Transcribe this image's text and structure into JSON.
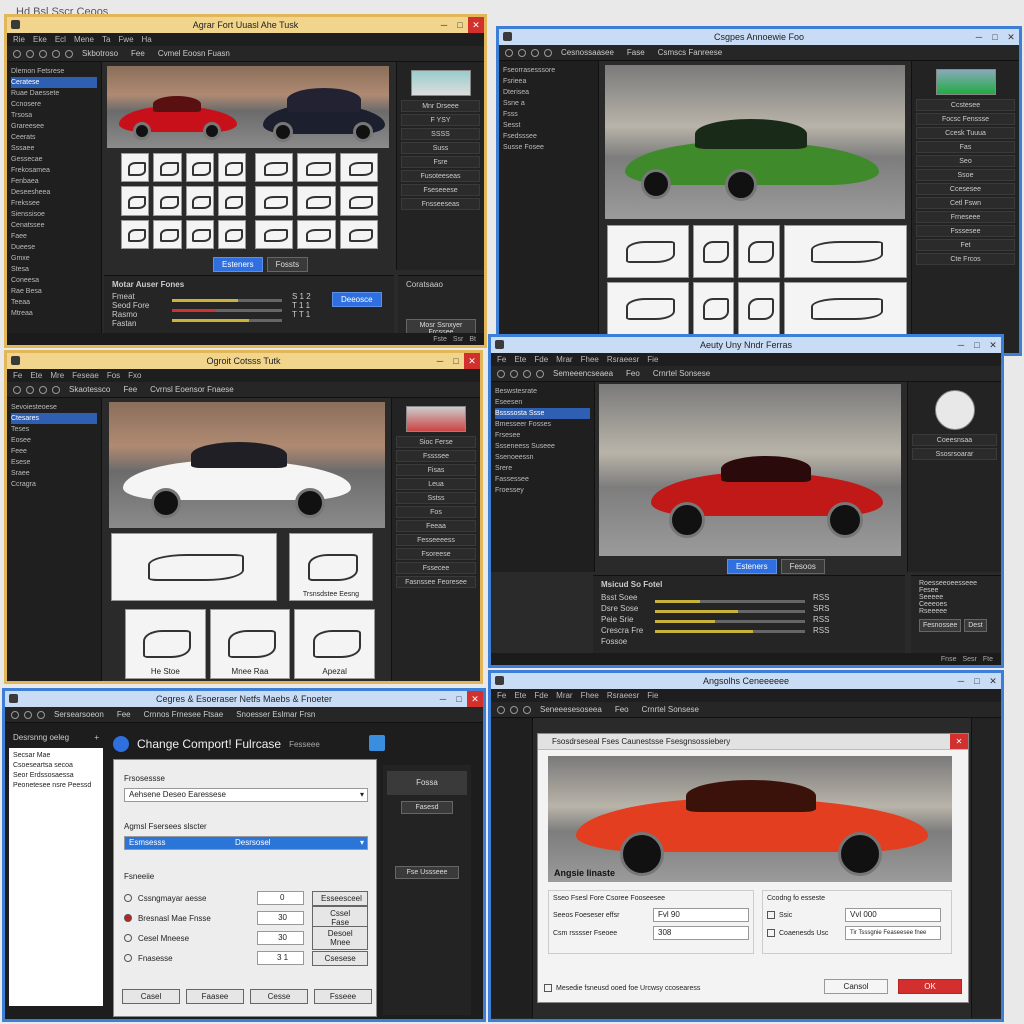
{
  "page": {
    "title": "Hd Bsl Sscr Ceoos"
  },
  "w1": {
    "title": "Agrar Fort Uuasl Ahe Tusk",
    "menu": [
      "Rie",
      "Eke",
      "Ecl",
      "Mene",
      "Ta",
      "Fwe",
      "Ha"
    ],
    "toolbar_labels": [
      "Skbotroso",
      "Fee",
      "Cvmel Eoosn Fuasn"
    ],
    "tree": [
      "Dlemon Fetsrese",
      "Ceratese",
      "Ruae Daessete",
      "Ccnosere",
      "Trsosa",
      "Grareesee",
      "Ceerats",
      "Sssaee",
      "Gessecae",
      "Frekosamea",
      "Fenbaea",
      "Deseesheea",
      "Frekssee",
      "Sienssisoe",
      "Cenatssee",
      "Faee",
      "Dueese",
      "Gmxe",
      "Stesa",
      "Coneesa",
      "Rae Besa",
      "Teeaa",
      "Mtreaa"
    ],
    "rpanel": [
      "Mnr Drseee",
      "F YSY",
      "SSSS",
      "Suss",
      "Fsre",
      "Fusoteeseas",
      "Fseseeese",
      "Fnsseeseas"
    ],
    "bottom_title": "Motar Auser Fones",
    "bottom_rows": [
      "Fmeat",
      "Seod Fore",
      "Rasmo",
      "Fastan"
    ],
    "bottom_vals": [
      "S 1 2",
      "T 1 1",
      "T T 1"
    ],
    "primary_btn": "Deeosce",
    "right_title": "Coratsaao",
    "right_btn": "Mosr Ssnxyer Frcssee",
    "tabs": [
      "Esteners",
      "Fossts"
    ],
    "status": [
      "Fste",
      "Ssr",
      "Bt"
    ]
  },
  "w2": {
    "title": "Csgpes Annoewie Foo",
    "toolbar_labels": [
      "Cesnossaasee",
      "Fase",
      "Csmscs Fanreese"
    ],
    "tree": [
      "Fseorrasesssore",
      "Fsrieea",
      "Dterisea",
      "Ssne a",
      "Fsss",
      "Sesst",
      "Fsedsssee",
      "Susse Fosee"
    ],
    "rpanel": [
      "Ccstesee",
      "Focsc Fenssse",
      "Ccesk Tuuua",
      "Fas",
      "Seo",
      "Ssoe",
      "Ccesesee",
      "Cetl Fswn",
      "Frneseee",
      "Fsssesee",
      "Fet",
      "Cte Frcos"
    ]
  },
  "w3": {
    "title": "Ogroit Cotsss Tutk",
    "menu": [
      "Fe",
      "Ete",
      "Mre",
      "Feseae",
      "Fos",
      "Fxo"
    ],
    "toolbar_labels": [
      "Skaotessco",
      "Fee",
      "Cvrnsl Eoensor Fnaese"
    ],
    "tree": [
      "Sevoiesteoese",
      "Ctesares",
      "Teses",
      "Eosee",
      "Feee",
      "Esese",
      "Sraee",
      "Ccragra"
    ],
    "rpanel": [
      "Sioc Ferse",
      "Fssssee",
      "Fisas",
      "Leua",
      "Sstss",
      "Fos",
      "Feeaa",
      "Fesseeeess",
      "Fsoreese",
      "Fssecee",
      "Fasnssee Feoresee"
    ],
    "part_caps": [
      "Trsnsdstee Eesng",
      "He Stoe",
      "Mnee Raa",
      "Apezal"
    ]
  },
  "w4": {
    "title": "Aeuty Uny Nndr Ferras",
    "menu": [
      "Fe",
      "Ete",
      "Fde",
      "Mrar",
      "Fhee",
      "Rsraeesr",
      "Fie"
    ],
    "toolbar_labels": [
      "Semeeencseaea",
      "Feo",
      "Crnrtel Sonsese"
    ],
    "tree": [
      "Beswstesrate",
      "Eseesen",
      "Bssssosta Ssse",
      "Bmesseer Fosses",
      "Frsesee",
      "Ssseneess Suseee",
      "Ssenoeessn",
      "Srere",
      "Fassessee",
      "Froessey"
    ],
    "bottom_title": "Msicud So Fotel",
    "bottom_rows": [
      "Bsst Soee",
      "Dsre Sose",
      "Peie Srie",
      "Crescra Fre",
      "Fossoe"
    ],
    "bottom_vals": [
      "RSS",
      "SRS",
      "RSS",
      "RSS"
    ],
    "right_title": "Roesseeoeesseee",
    "right_rows": [
      "Fesee",
      "Seeeee",
      "Ceeeoes",
      "Rseeeee"
    ],
    "right_btn": "Fesnossee",
    "right_btn2": "Dest",
    "tabs": [
      "Esteners",
      "Fesoos"
    ],
    "status": [
      "Fnse",
      "Sesr",
      "Fte"
    ],
    "rpanel": [
      "Coeesnsaa",
      "Ssosrsoarar"
    ]
  },
  "w5": {
    "title": "Cegres & Esoeraser Netfs Maebs & Fnoeter",
    "toolbar_labels": [
      "Sersearsoeon",
      "Fee",
      "Crnnos Frnesee Ftsae",
      "Snoesser Eslmar Frsn"
    ],
    "sidebar_title": "Desrsnng oeleg",
    "sidebar_items": [
      "Secsar Mae",
      "Csoeseartsa secoa",
      "Seor Erdssosaessa",
      "Peonetesee nsre Peessd"
    ],
    "header": "Change Comport! Fulrcase",
    "header_tag": "Fesseee",
    "section1_label": "Frsosessse",
    "dropdown1": "Aehsene Deseo Earessese",
    "section2_label": "Agmsl Fsersees slscter",
    "dropdown2_left": "Esmsesss",
    "dropdown2_right": "Desrsosel",
    "section3_label": "Fsneeiie",
    "radios": [
      "Cssngmayar aesse",
      "Bresnasl Mae Fnsse",
      "Cesel Mneese",
      "Fnasesse"
    ],
    "inputs": [
      "0",
      "30",
      "30",
      "3 1"
    ],
    "side_btns": [
      "Esseesceel",
      "Cssel Fase",
      "Desoel Mnee",
      "Csesese"
    ],
    "footer_btns": [
      "Casel",
      "Faasee",
      "Cesse",
      "Fsseee"
    ],
    "right_btns": [
      "Fossa",
      "Fasesd",
      "Fse Ussseee"
    ]
  },
  "w6": {
    "title": "Angsolhs Ceneeeeee",
    "menu": [
      "Fe",
      "Ete",
      "Fde",
      "Mrar",
      "Fhee",
      "Rsraeesr",
      "Fie"
    ],
    "toolbar_labels": [
      "Seneeesesoseea",
      "Feo",
      "Crnrtel Sonsese"
    ],
    "dialog_title": "Fsosdrseseal Fses Caunestsse Fsesgnsossiebery",
    "image_caption": "Angsie Iinaste",
    "left_group": "Sseo Fsesl Fore Csoree Fooseesee",
    "left_rows": [
      "Seeos Foeseser effsr",
      "Csm rsssser Fseoee"
    ],
    "left_vals": [
      "Fvl 90",
      "308"
    ],
    "right_group": "Ccodng fo esseste",
    "right_rows": [
      "Ssic",
      "Coaenesds Usc"
    ],
    "right_vals": [
      "Vvl 000",
      "Tir Tsssgnie Feaseesee fnee"
    ],
    "check": "Mesedie fsneusd ooed foe Urcwsy ccosearess",
    "cancel": "Cansol",
    "ok": "OK"
  },
  "colors": {
    "accent_gold": "#e2b75a",
    "accent_blue": "#3d7fd6",
    "close_red": "#d2302c",
    "primary": "#2f6fe0"
  }
}
